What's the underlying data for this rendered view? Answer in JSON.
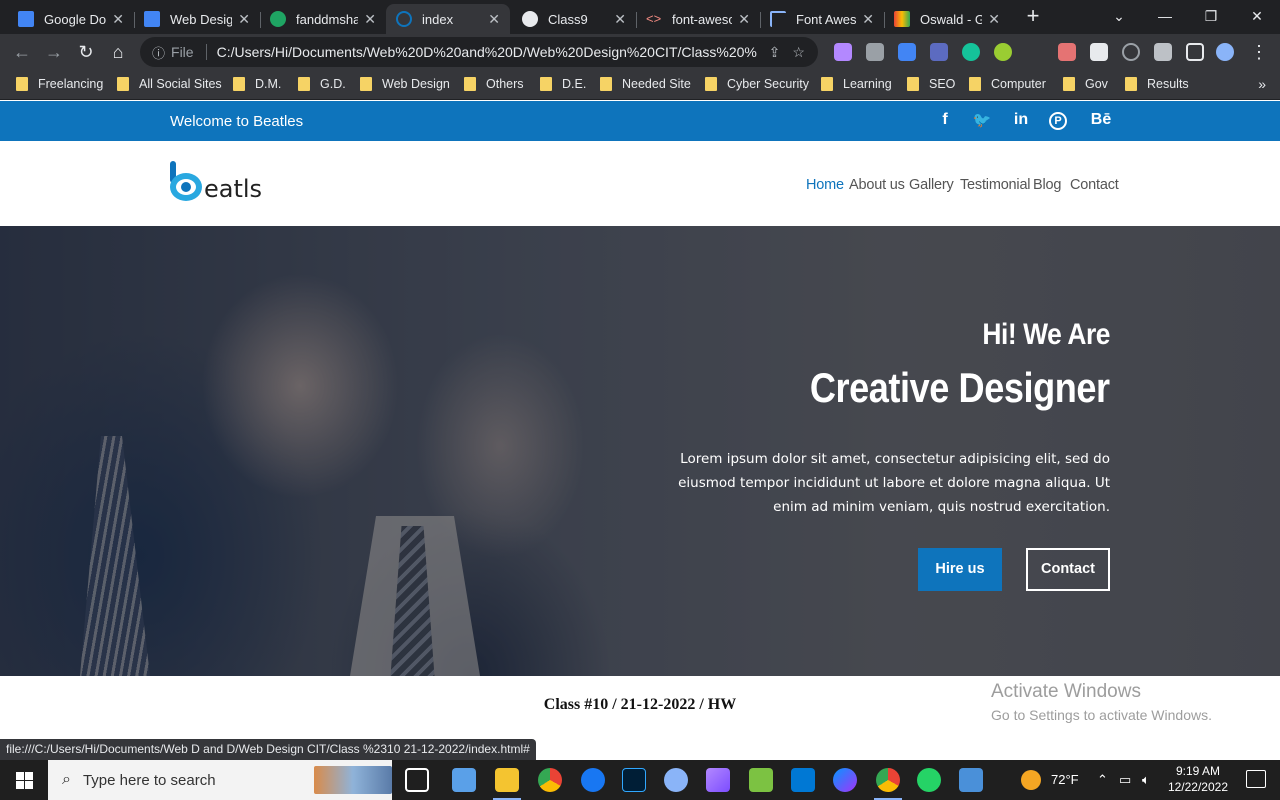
{
  "browser": {
    "tabs": [
      {
        "title": "Google Doc",
        "favicon_color": "#4285f4"
      },
      {
        "title": "Web Design",
        "favicon_color": "#4285f4"
      },
      {
        "title": "fanddmsha",
        "favicon_color": "#1fa463"
      },
      {
        "title": "index",
        "favicon_color": "#0e74bc",
        "active": true
      },
      {
        "title": "Class9",
        "favicon_color": "#e8eaed"
      },
      {
        "title": "font-aweso",
        "favicon_color": "#f28b82"
      },
      {
        "title": "Font Aweso",
        "favicon_color": "#8ab4f8"
      },
      {
        "title": "Oswald - G",
        "favicon_color": "#ea4335"
      }
    ],
    "close_glyph": "✕",
    "new_tab_glyph": "+",
    "window_controls": {
      "list": "⌄",
      "minimize": "—",
      "restore": "❐",
      "close": "✕"
    },
    "toolbar": {
      "back": "←",
      "forward": "→",
      "reload": "↻",
      "home": "⌂",
      "security_icon": "ⓘ",
      "file_label": "File",
      "url": "C:/Users/Hi/Documents/Web%20D%20and%20D/Web%20Design%20CIT/Class%20%...",
      "share_icon": "⇪",
      "star_icon": "☆",
      "menu_icon": "⋮"
    },
    "bookmarks": [
      "Freelancing",
      "All Social Sites",
      "D.M.",
      "G.D.",
      "Web Design",
      "Others",
      "D.E.",
      "Needed Site",
      "Cyber Security",
      "Learning",
      "SEO",
      "Computer",
      "Gov",
      "Results"
    ],
    "bookmarks_more": "»",
    "status_url": "file:///C:/Users/Hi/Documents/Web D and D/Web Design CIT/Class %2310 21-12-2022/index.html#"
  },
  "site": {
    "welcome": "Welcome to Beatles",
    "social": {
      "facebook": "f",
      "twitter": "🐦",
      "linkedin": "in",
      "pinterest": "P",
      "behance": "Bē"
    },
    "logo_text": "eatls",
    "nav": [
      "Home",
      "About us",
      "Gallery",
      "Testimonial",
      "Blog",
      "Contact"
    ],
    "hero": {
      "subtitle": "Hi! We Are",
      "title": "Creative Designer",
      "description": "Lorem ipsum dolor sit amet, consectetur adipisicing elit, sed do eiusmod tempor incididunt ut labore et dolore magna aliqua. Ut enim ad minim veniam, quis nostrud exercitation.",
      "hire_label": "Hire us",
      "contact_label": "Contact"
    },
    "footer_note": "Class #10 / 21-12-2022 / HW",
    "brand_color": "#0e74bc"
  },
  "windows": {
    "activate_title": "Activate Windows",
    "activate_sub": "Go to Settings to activate Windows.",
    "search_placeholder": "Type here to search",
    "weather": "72°F",
    "tray_chevron": "⌃",
    "time": "9:19 AM",
    "date": "12/22/2022"
  }
}
